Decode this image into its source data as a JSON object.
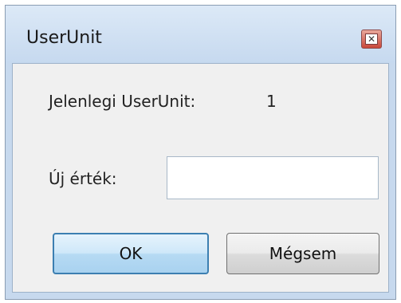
{
  "window": {
    "title": "UserUnit",
    "close_icon": "close-icon"
  },
  "dialog": {
    "current_label": "Jelenlegi UserUnit:",
    "current_value": "1",
    "new_value_label": "Új érték:",
    "new_value_input": "",
    "ok_label": "OK",
    "cancel_label": "Mégsem"
  }
}
